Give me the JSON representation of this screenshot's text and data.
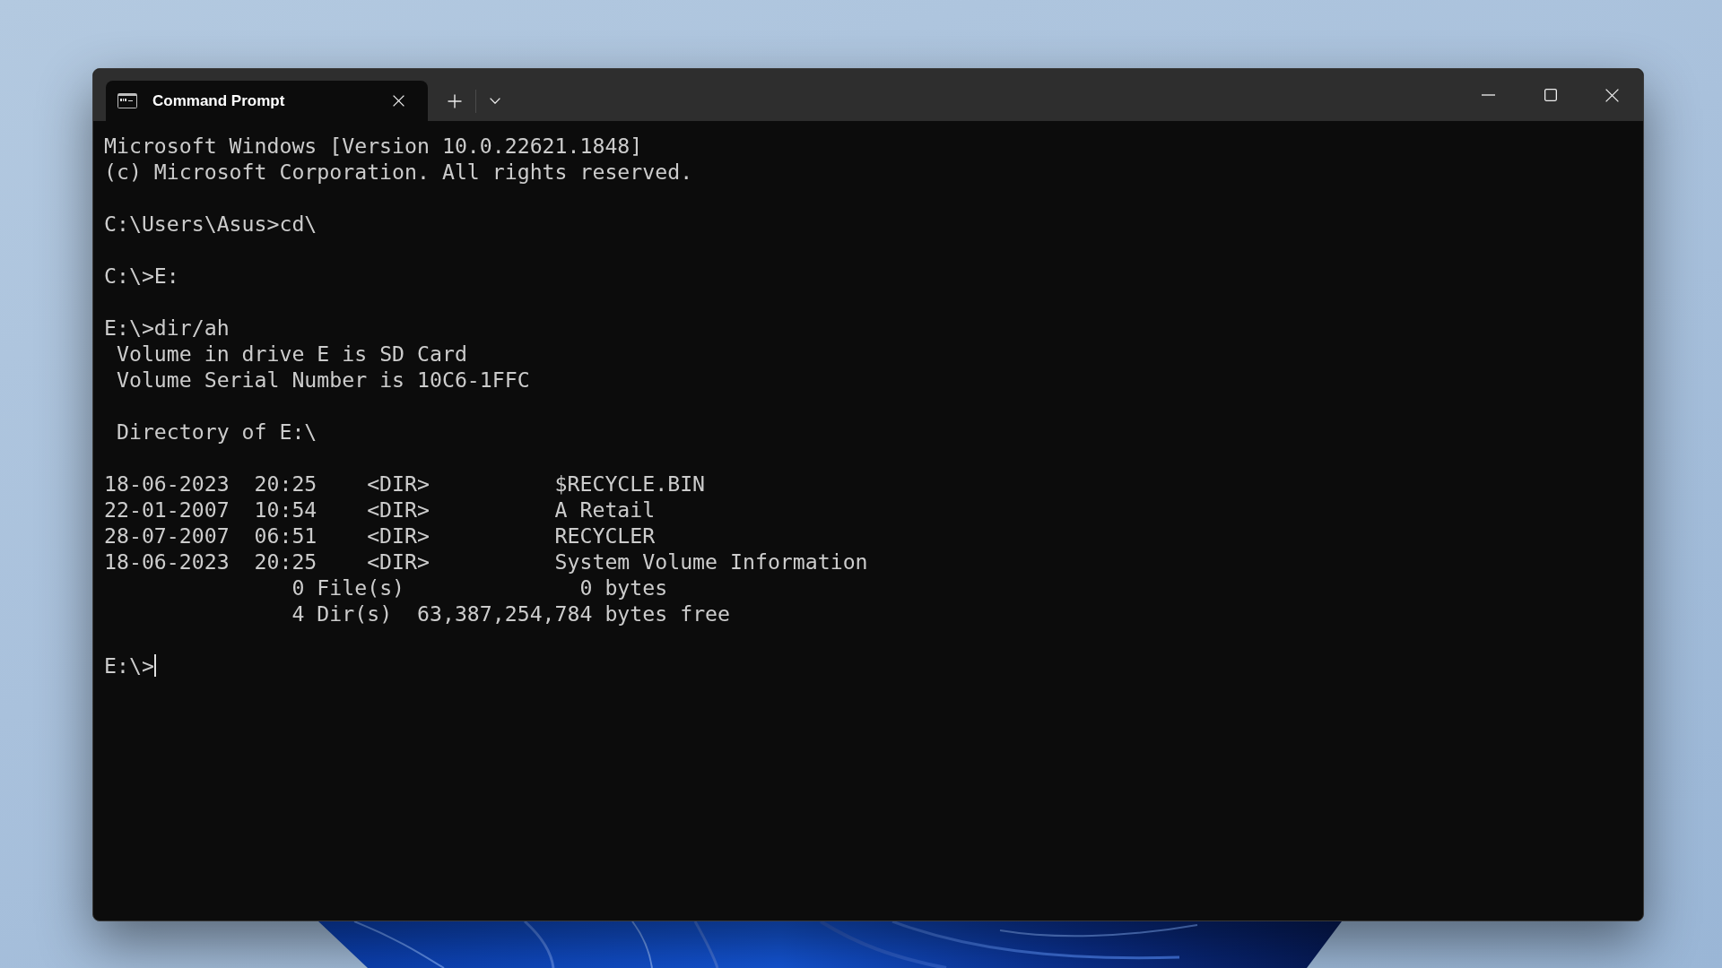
{
  "window": {
    "tabs": [
      {
        "title": "Command Prompt",
        "selected": true
      }
    ]
  },
  "terminal": {
    "blocks": [
      [
        "Microsoft Windows [Version 10.0.22621.1848]",
        "(c) Microsoft Corporation. All rights reserved."
      ],
      [
        "C:\\Users\\Asus>cd\\"
      ],
      [
        "C:\\>E:"
      ],
      [
        "E:\\>dir/ah",
        " Volume in drive E is SD Card",
        " Volume Serial Number is 10C6-1FFC"
      ],
      [
        " Directory of E:\\"
      ],
      [
        "18-06-2023  20:25    <DIR>          $RECYCLE.BIN",
        "22-01-2007  10:54    <DIR>          A Retail",
        "28-07-2007  06:51    <DIR>          RECYCLER",
        "18-06-2023  20:25    <DIR>          System Volume Information",
        "               0 File(s)              0 bytes",
        "               4 Dir(s)  63,387,254,784 bytes free"
      ]
    ],
    "prompt": {
      "text": "E:\\>",
      "cursor": true
    }
  }
}
